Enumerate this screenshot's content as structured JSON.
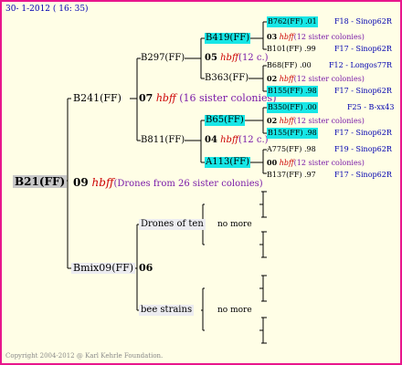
{
  "header": {
    "date_text": "30-  1-2012 ( 16: 35)"
  },
  "footer": {
    "copyright": "Copyright 2004-2012 @ Karl Kehrle Foundation."
  },
  "root": {
    "name": "B21(FF)",
    "gen_num": "09",
    "hbff": "hbff",
    "note": "(Drones from 26 sister colonies)"
  },
  "left": {
    "top": {
      "name": "B241(FF)",
      "gen_num": "07",
      "hbff": "hbff",
      "note": "(16 sister colonies)"
    },
    "bottom": {
      "name": "Bmix09(FF)",
      "gen_num": "06"
    }
  },
  "mid": {
    "b297": "B297(FF)",
    "b811": "B811(FF)",
    "drones": "Drones of ten",
    "bee": "bee strains",
    "nomore1": "no more",
    "nomore2": "no more"
  },
  "inner": {
    "b419": "B419(FF)",
    "n05": "05",
    "hbff05": "hbff",
    "note05": "(12 c.)",
    "b363": "B363(FF)",
    "b65": "B65(FF)",
    "n04": "04",
    "hbff04": "hbff",
    "note04": "(12 c.)",
    "a113": "A113(FF)"
  },
  "leaves": {
    "l1": {
      "name": "B762(FF)",
      "val": ".01",
      "ref": "F18 - Sinop62R"
    },
    "l2": {
      "num": "03",
      "hbff": "hbff",
      "note": "(12 sister colonies)"
    },
    "l3": {
      "name": "B101(FF)",
      "val": ".99",
      "ref": "F17 - Sinop62R"
    },
    "l4": {
      "name": "B68(FF)",
      "val": ".00",
      "ref": "F12 - Longos77R"
    },
    "l5": {
      "num": "02",
      "hbff": "hbff",
      "note": "(12 sister colonies)"
    },
    "l6": {
      "name": "B155(FF)",
      "val": ".98",
      "ref": "F17 - Sinop62R"
    },
    "l7": {
      "name": "B350(FF)",
      "val": ".00",
      "ref": "F25 - B-xx43"
    },
    "l8": {
      "num": "02",
      "hbff": "hbff",
      "note": "(12 sister colonies)"
    },
    "l9": {
      "name": "B155(FF)",
      "val": ".98",
      "ref": "F17 - Sinop62R"
    },
    "l10": {
      "name": "A775(FF)",
      "val": ".98",
      "ref": "F19 - Sinop62R"
    },
    "l11": {
      "num": "00",
      "hbff": "hbff",
      "note": "(12 sister colonies)"
    },
    "l12": {
      "name": "B137(FF)",
      "val": ".97",
      "ref": "F17 - Sinop62R"
    }
  }
}
